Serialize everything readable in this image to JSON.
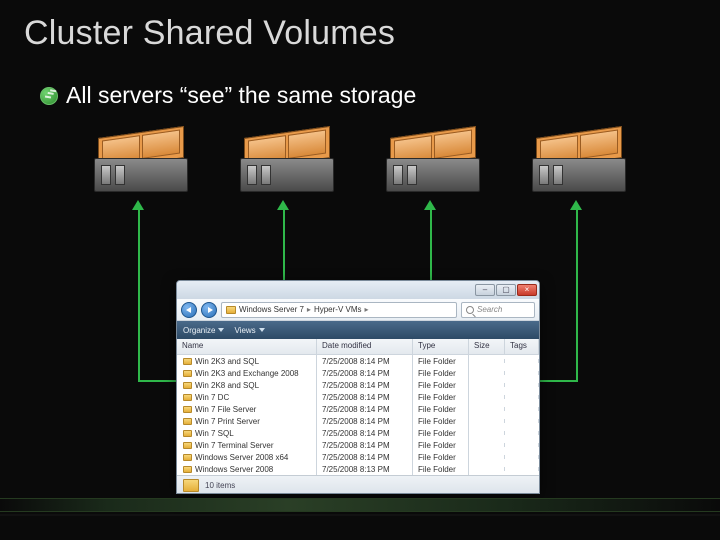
{
  "slide": {
    "title": "Cluster Shared Volumes",
    "bullet": "All servers “see” the same storage"
  },
  "explorer": {
    "breadcrumb": [
      "Windows Server 7",
      "Hyper-V VMs"
    ],
    "search_placeholder": "Search",
    "toolbar": {
      "organize": "Organize",
      "views": "Views"
    },
    "columns": {
      "name": "Name",
      "date": "Date modified",
      "type": "Type",
      "size": "Size",
      "tags": "Tags"
    },
    "files": [
      {
        "name": "Win 2K3 and SQL",
        "date": "7/25/2008 8:14 PM",
        "type": "File Folder"
      },
      {
        "name": "Win 2K3 and Exchange 2008",
        "date": "7/25/2008 8:14 PM",
        "type": "File Folder"
      },
      {
        "name": "Win 2K8 and SQL",
        "date": "7/25/2008 8:14 PM",
        "type": "File Folder"
      },
      {
        "name": "Win 7  DC",
        "date": "7/25/2008 8:14 PM",
        "type": "File Folder"
      },
      {
        "name": "Win 7  File Server",
        "date": "7/25/2008 8:14 PM",
        "type": "File Folder"
      },
      {
        "name": "Win 7  Print Server",
        "date": "7/25/2008 8:14 PM",
        "type": "File Folder"
      },
      {
        "name": "Win 7  SQL",
        "date": "7/25/2008 8:14 PM",
        "type": "File Folder"
      },
      {
        "name": "Win 7  Terminal Server",
        "date": "7/25/2008 8:14 PM",
        "type": "File Folder"
      },
      {
        "name": "Windows Server 2008 x64",
        "date": "7/25/2008 8:14 PM",
        "type": "File Folder"
      },
      {
        "name": "Windows Server 2008",
        "date": "7/25/2008 8:13 PM",
        "type": "File Folder"
      }
    ],
    "status": "10 items"
  }
}
